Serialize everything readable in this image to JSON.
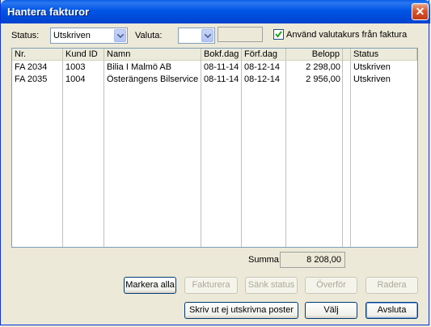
{
  "window": {
    "title": "Hantera fakturor",
    "close_glyph": "✕"
  },
  "filters": {
    "status_label": "Status:",
    "status_value": "Utskriven",
    "valuta_label": "Valuta:",
    "valuta_value": "",
    "valuta_rate": "",
    "use_rate_label": "Använd valutakurs från faktura",
    "use_rate_checked": true
  },
  "table": {
    "columns": [
      "Nr.",
      "Kund ID",
      "Namn",
      "Bokf.dag",
      "Förf.dag",
      "Belopp",
      "",
      "Status"
    ],
    "rows": [
      [
        "FA 2034",
        "1003",
        "Bilia I Malmö AB",
        "08-11-14",
        "08-12-14",
        "2 298,00",
        "",
        "Utskriven"
      ],
      [
        "FA 2035",
        "1004",
        "Österängens Bilservice",
        "08-11-14",
        "08-12-14",
        "2 956,00",
        "",
        "Utskriven"
      ]
    ]
  },
  "summary": {
    "label": "Summa:",
    "value": "8 208,00"
  },
  "buttons": {
    "mark_all": "Markera alla",
    "invoice": "Fakturera",
    "lower_status": "Sänk status",
    "transfer": "Överför",
    "delete": "Radera",
    "print_unprinted": "Skriv ut ej utskrivna poster",
    "select": "Välj",
    "close": "Avsluta"
  },
  "colors": {
    "titlebar": "#0055e5",
    "face": "#ece9d8",
    "border": "#7f9db9"
  }
}
